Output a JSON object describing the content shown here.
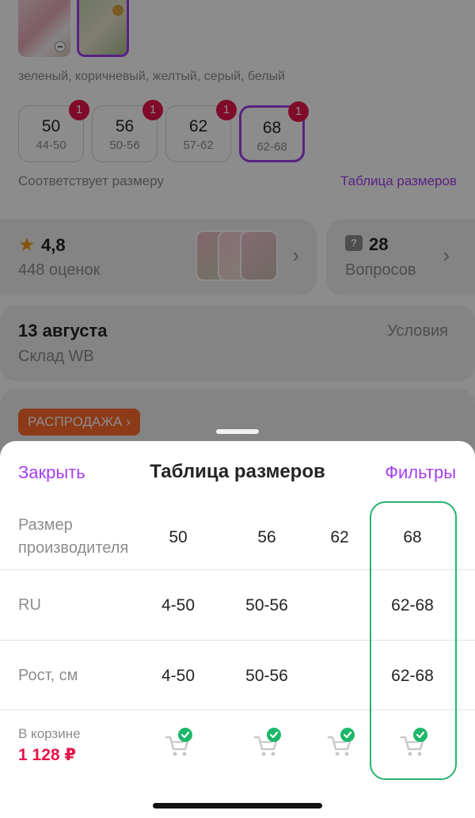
{
  "product": {
    "colors": "зеленый, коричневый, желтый, серый, белый",
    "sizes": [
      {
        "size": "50",
        "range": "44-50",
        "count": "1",
        "selected": false
      },
      {
        "size": "56",
        "range": "50-56",
        "count": "1",
        "selected": false
      },
      {
        "size": "62",
        "range": "57-62",
        "count": "1",
        "selected": false
      },
      {
        "size": "68",
        "range": "62-68",
        "count": "1",
        "selected": true
      }
    ],
    "fit_text": "Соответствует размеру",
    "size_table_link": "Таблица размеров",
    "rating": {
      "score": "4,8",
      "reviews": "448 оценок"
    },
    "questions": {
      "count": "28",
      "label": "Вопросов"
    },
    "delivery": {
      "date": "13 августа",
      "warehouse": "Склад WB",
      "terms": "Условия"
    },
    "sale_badge": "РАСПРОДАЖА ›"
  },
  "sheet": {
    "close": "Закрыть",
    "title": "Таблица размеров",
    "filters": "Фильтры",
    "rows": [
      {
        "label": "Размер\nпроизводителя",
        "values": [
          "50",
          "56",
          "62",
          "68"
        ]
      },
      {
        "label": "RU",
        "values": [
          "4-50",
          "50-56",
          "",
          "62-68"
        ]
      },
      {
        "label": "Рост, см",
        "values": [
          "4-50",
          "50-56",
          "",
          "62-68"
        ]
      }
    ],
    "cart": {
      "label": "В корзине",
      "price": "1 128 ₽"
    }
  },
  "colors": {
    "accent": "#a33ef0",
    "price": "#e8134b",
    "highlight": "#25b36b",
    "check": "#1cb76a"
  }
}
